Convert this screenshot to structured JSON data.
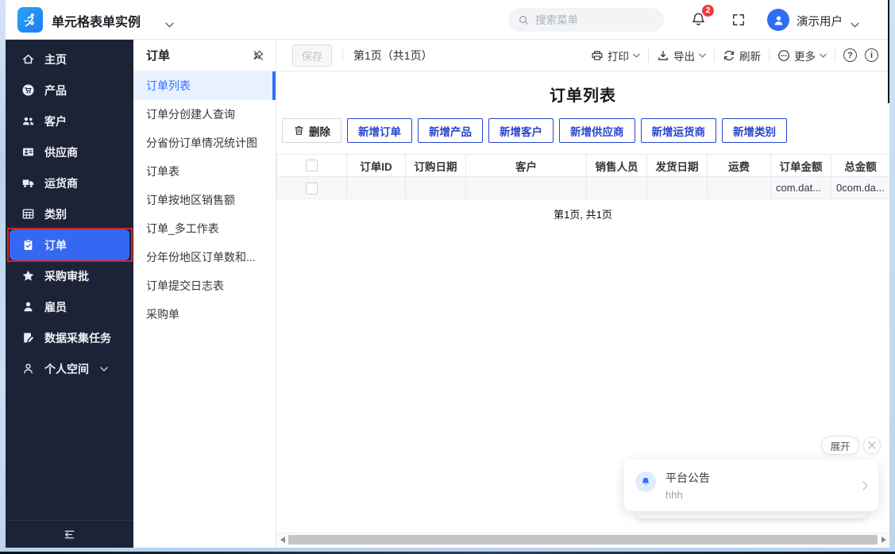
{
  "app": {
    "title": "单元格表单实例",
    "search_placeholder": "搜索菜单",
    "notification_count": "2",
    "user_name": "演示用户"
  },
  "sidebar": {
    "items": [
      {
        "label": "主页",
        "icon": "home-icon"
      },
      {
        "label": "产品",
        "icon": "product-icon"
      },
      {
        "label": "客户",
        "icon": "customers-icon"
      },
      {
        "label": "供应商",
        "icon": "supplier-icon"
      },
      {
        "label": "运货商",
        "icon": "shipper-icon"
      },
      {
        "label": "类别",
        "icon": "category-icon"
      },
      {
        "label": "订单",
        "icon": "orders-icon",
        "selected": true
      },
      {
        "label": "采购审批",
        "icon": "approval-star-icon"
      },
      {
        "label": "雇员",
        "icon": "employee-icon"
      },
      {
        "label": "数据采集任务",
        "icon": "data-task-icon"
      },
      {
        "label": "个人空间",
        "icon": "personal-space-icon"
      }
    ]
  },
  "submenu": {
    "title": "订单",
    "items": [
      {
        "label": "订单列表",
        "selected": true
      },
      {
        "label": "订单分创建人查询"
      },
      {
        "label": "分省份订单情况统计图"
      },
      {
        "label": "订单表"
      },
      {
        "label": "订单按地区销售额"
      },
      {
        "label": "订单_多工作表"
      },
      {
        "label": "分年份地区订单数和..."
      },
      {
        "label": "订单提交日志表"
      },
      {
        "label": "采购单"
      }
    ]
  },
  "toolbar": {
    "save": "保存",
    "page_info": "第1页（共1页）",
    "print": "打印",
    "export": "导出",
    "refresh": "刷新",
    "more": "更多",
    "help_glyph": "?",
    "info_glyph": "i"
  },
  "content": {
    "title": "订单列表",
    "buttons": [
      {
        "label": "删除",
        "style": "default"
      },
      {
        "label": "新增订单",
        "style": "primary"
      },
      {
        "label": "新增产品",
        "style": "primary"
      },
      {
        "label": "新增客户",
        "style": "primary"
      },
      {
        "label": "新增供应商",
        "style": "primary"
      },
      {
        "label": "新增运货商",
        "style": "primary"
      },
      {
        "label": "新增类别",
        "style": "primary"
      }
    ],
    "table": {
      "columns": [
        "订单ID",
        "订购日期",
        "客户",
        "销售人员",
        "发货日期",
        "运费",
        "订单金额",
        "总金额"
      ],
      "rows": [
        {
          "cells": [
            "",
            "",
            "",
            "",
            "",
            "",
            "com.dat...",
            "0com.da..."
          ]
        }
      ]
    },
    "pagination": "第1页, 共1页"
  },
  "notification": {
    "expand": "展开",
    "title": "平台公告",
    "body": "hhh"
  },
  "colors": {
    "accent_blue": "#3370ff",
    "selected_nav_blue": "#3568f2",
    "badge_red": "#f43b3b",
    "annotation_red": "#e01e1e",
    "button_blue": "#2945cc",
    "sidebar_bg": "#1c2336"
  }
}
